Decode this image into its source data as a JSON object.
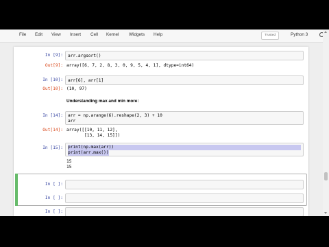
{
  "menu": {
    "items": [
      "File",
      "Edit",
      "View",
      "Insert",
      "Cell",
      "Kernel",
      "Widgets",
      "Help"
    ],
    "trusted": "Trusted",
    "kernel": "Python 3"
  },
  "cells": {
    "c9_in": {
      "prompt": "In [9]:",
      "code": "arr.argsort()"
    },
    "c9_out": {
      "prompt": "Out[9]:",
      "text": "array([6, 7, 2, 8, 3, 0, 9, 5, 4, 1], dtype=int64)"
    },
    "c10_in": {
      "prompt": "In [10]:",
      "code": "arr[6], arr[1]"
    },
    "c10_out": {
      "prompt": "Out[10]:",
      "text": "(10, 97)"
    },
    "md": {
      "text": "Understanding max and min more:"
    },
    "c14_in": {
      "prompt": "In [14]:",
      "line1": "arr = np.arange(6).reshape(2, 3) + 10",
      "line2": "arr"
    },
    "c14_out": {
      "prompt": "Out[14]:",
      "line1": "array([[10, 11, 12],",
      "line2": "       [13, 14, 15]])"
    },
    "c15_in": {
      "prompt": "In [15]:",
      "line1": "print(np.max(arr))",
      "line2": "print(arr.max())"
    },
    "c15_out": {
      "line1": "15",
      "line2": "15"
    },
    "empty_prompt": "In [ ]:"
  },
  "colors": {
    "in_prompt": "#303f9f",
    "out_prompt": "#d84315",
    "selected_border": "#42a5f5",
    "selected_bar": "#66bb6a"
  }
}
